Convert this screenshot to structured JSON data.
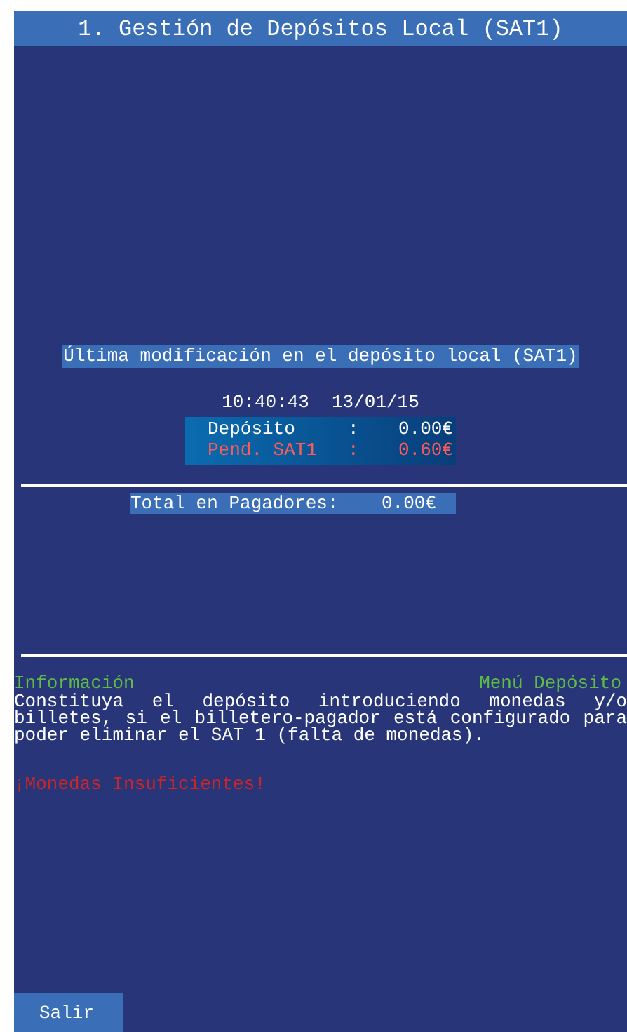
{
  "window": {
    "title": "1. Gestión de Depósitos Local (SAT1)"
  },
  "last_modified": {
    "heading": "Última modificación en el depósito local (SAT1)",
    "time": "10:40:43",
    "date": "13/01/15",
    "rows": [
      {
        "label": "Depósito",
        "separator": ":",
        "value": "0.00€",
        "kind": "normal"
      },
      {
        "label": "Pend. SAT1",
        "separator": ":",
        "value": "0.60€",
        "kind": "warning"
      }
    ]
  },
  "total": {
    "label": "Total en Pagadores:",
    "value": "0.00€"
  },
  "info": {
    "title": "Información",
    "menu": "Menú Depósito",
    "message": "Constituya el depósito introduciendo monedas y/o billetes, si el billetero-pagador está configurado para poder eliminar el SAT 1 (falta de monedas).",
    "alert": "¡Monedas Insuficientes!"
  },
  "buttons": [
    {
      "label": "Salir"
    }
  ]
}
